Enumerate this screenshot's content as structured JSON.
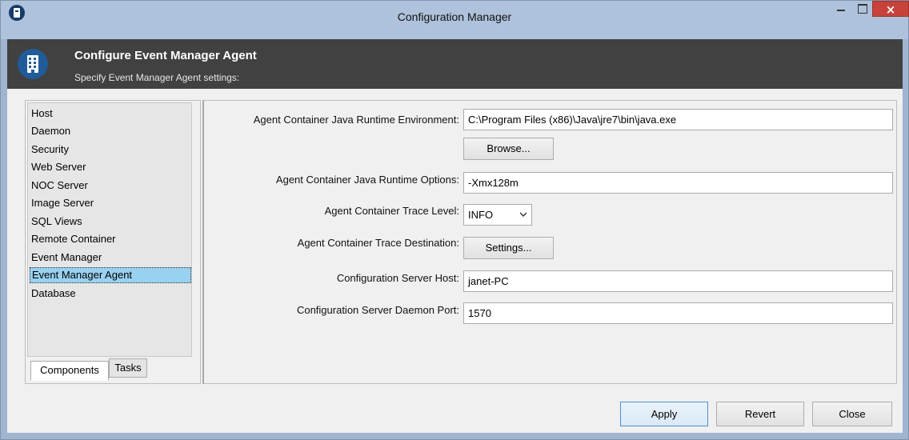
{
  "window": {
    "title": "Configuration Manager",
    "close_glyph": "×",
    "app_icon": "building-icon"
  },
  "header": {
    "title": "Configure Event Manager Agent",
    "subtitle": "Specify Event Manager Agent settings:",
    "icon": "building-icon"
  },
  "sidebar": {
    "items": [
      {
        "label": "Host"
      },
      {
        "label": "Daemon"
      },
      {
        "label": "Security"
      },
      {
        "label": "Web Server"
      },
      {
        "label": "NOC Server"
      },
      {
        "label": "Image Server"
      },
      {
        "label": "SQL Views"
      },
      {
        "label": "Remote Container"
      },
      {
        "label": "Event Manager"
      },
      {
        "label": "Event Manager Agent"
      },
      {
        "label": "Database"
      }
    ],
    "selected": "Event Manager Agent",
    "tabs": [
      {
        "label": "Components"
      },
      {
        "label": "Tasks"
      }
    ]
  },
  "form": {
    "jre": {
      "label": "Agent Container Java Runtime Environment:",
      "value": "C:\\Program Files (x86)\\Java\\jre7\\bin\\java.exe",
      "browse_label": "Browse..."
    },
    "options": {
      "label": "Agent Container Java Runtime Options:",
      "value": "-Xmx128m"
    },
    "trace_level": {
      "label": "Agent Container Trace Level:",
      "value": "INFO"
    },
    "trace_dest": {
      "label": "Agent Container Trace Destination:",
      "button_label": "Settings..."
    },
    "server_host": {
      "label": "Configuration Server Host:",
      "value": "janet-PC"
    },
    "daemon_port": {
      "label": "Configuration Server Daemon Port:",
      "value": "1570"
    }
  },
  "footer": {
    "apply_label": "Apply",
    "revert_label": "Revert",
    "close_label": "Close"
  },
  "colors": {
    "banner": "#414141",
    "selection": "#99d1f0",
    "titlebar": "#aec2db",
    "close": "#c7423a"
  }
}
